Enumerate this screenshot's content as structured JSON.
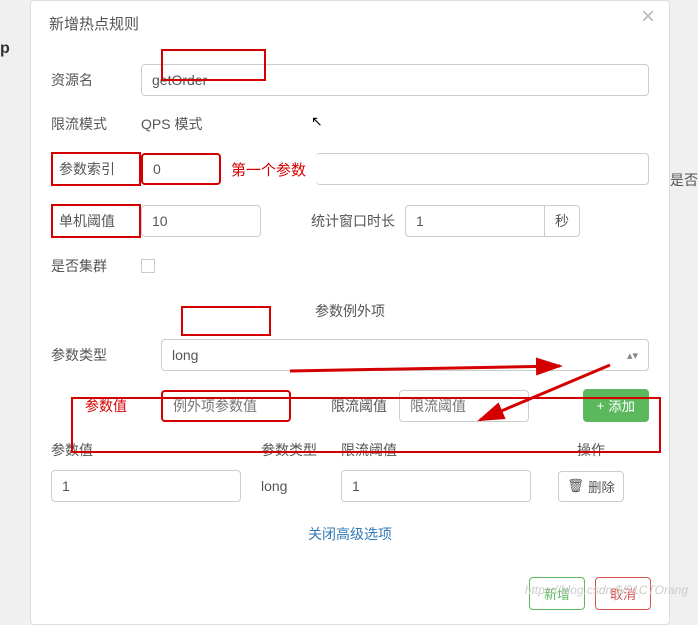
{
  "bg": {
    "left": "p",
    "right": "是否"
  },
  "modal": {
    "title": "新增热点规则",
    "labels": {
      "resource": "资源名",
      "mode": "限流模式",
      "param_index": "参数索引",
      "single_threshold": "单机阈值",
      "stat_window": "统计窗口时长",
      "is_cluster": "是否集群",
      "section": "参数例外项",
      "param_type": "参数类型",
      "param_value": "参数值",
      "limit_threshold": "限流阈值",
      "operation": "操作"
    },
    "values": {
      "resource": "getOrder",
      "mode": "QPS 模式",
      "param_index": "0",
      "single_threshold": "10",
      "stat_window": "1",
      "stat_unit": "秒",
      "param_type": "long",
      "exception_value_placeholder": "例外项参数值",
      "limit_threshold_placeholder": "限流阈值"
    },
    "annotations": {
      "first_param": "第一个参数"
    },
    "table": {
      "headers": {
        "value": "参数值",
        "type": "参数类型",
        "threshold": "限流阈值",
        "op": "操作"
      },
      "rows": [
        {
          "value": "1",
          "type": "long",
          "threshold": "1"
        }
      ]
    },
    "buttons": {
      "add": "添加",
      "delete": "删除",
      "close_advanced": "关闭高级选项",
      "confirm": "新增",
      "cancel": "取消"
    }
  },
  "watermark": "https://blog.csdn.$/51CTOrang"
}
